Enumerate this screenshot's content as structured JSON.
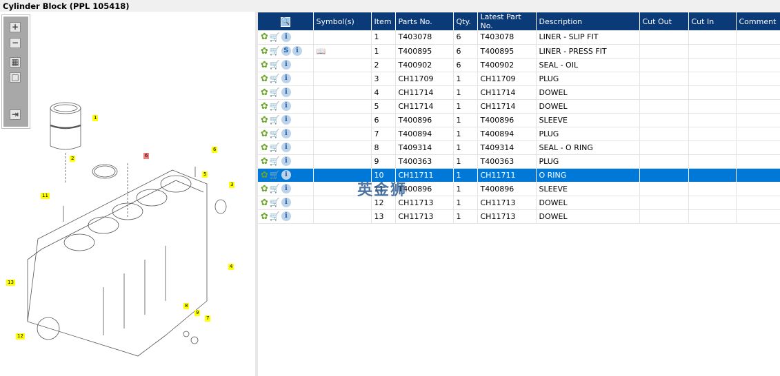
{
  "title": "Cylinder Block (PPL 105418)",
  "toolbar": {
    "zoom_in": "+",
    "zoom_out": "−",
    "fit": "▦",
    "actual": "□",
    "export": "⇥"
  },
  "callouts": [
    "1",
    "2",
    "3",
    "4",
    "5",
    "6",
    "7",
    "8",
    "9",
    "11",
    "12",
    "13",
    "6"
  ],
  "table": {
    "headers": [
      "Symbol(s)",
      "Item",
      "Parts No.",
      "Qty.",
      "Latest Part No.",
      "Description",
      "Cut Out",
      "Cut In",
      "Comment"
    ],
    "rows": [
      {
        "s": false,
        "sym": false,
        "item": "1",
        "part": "T403078",
        "qty": "6",
        "latest": "T403078",
        "desc": "LINER - SLIP FIT"
      },
      {
        "s": true,
        "sym": true,
        "item": "1",
        "part": "T400895",
        "qty": "6",
        "latest": "T400895",
        "desc": "LINER - PRESS FIT"
      },
      {
        "s": false,
        "sym": false,
        "item": "2",
        "part": "T400902",
        "qty": "6",
        "latest": "T400902",
        "desc": "SEAL - OIL"
      },
      {
        "s": false,
        "sym": false,
        "item": "3",
        "part": "CH11709",
        "qty": "1",
        "latest": "CH11709",
        "desc": "PLUG"
      },
      {
        "s": false,
        "sym": false,
        "item": "4",
        "part": "CH11714",
        "qty": "1",
        "latest": "CH11714",
        "desc": "DOWEL"
      },
      {
        "s": false,
        "sym": false,
        "item": "5",
        "part": "CH11714",
        "qty": "1",
        "latest": "CH11714",
        "desc": "DOWEL"
      },
      {
        "s": false,
        "sym": false,
        "item": "6",
        "part": "T400896",
        "qty": "1",
        "latest": "T400896",
        "desc": "SLEEVE"
      },
      {
        "s": false,
        "sym": false,
        "item": "7",
        "part": "T400894",
        "qty": "1",
        "latest": "T400894",
        "desc": "PLUG"
      },
      {
        "s": false,
        "sym": false,
        "item": "8",
        "part": "T409314",
        "qty": "1",
        "latest": "T409314",
        "desc": "SEAL - O RING"
      },
      {
        "s": false,
        "sym": false,
        "item": "9",
        "part": "T400363",
        "qty": "1",
        "latest": "T400363",
        "desc": "PLUG"
      },
      {
        "s": false,
        "sym": false,
        "item": "10",
        "part": "CH11711",
        "qty": "1",
        "latest": "CH11711",
        "desc": "O RING",
        "selected": true
      },
      {
        "s": false,
        "sym": false,
        "item": "11",
        "part": "T400896",
        "qty": "1",
        "latest": "T400896",
        "desc": "SLEEVE"
      },
      {
        "s": false,
        "sym": false,
        "item": "12",
        "part": "CH11713",
        "qty": "1",
        "latest": "CH11713",
        "desc": "DOWEL"
      },
      {
        "s": false,
        "sym": false,
        "item": "13",
        "part": "CH11713",
        "qty": "1",
        "latest": "CH11713",
        "desc": "DOWEL"
      }
    ]
  },
  "watermark": "英金狮",
  "colors": {
    "header": "#0b3a78",
    "selected": "#0078d7",
    "callout": "#ffff00"
  }
}
